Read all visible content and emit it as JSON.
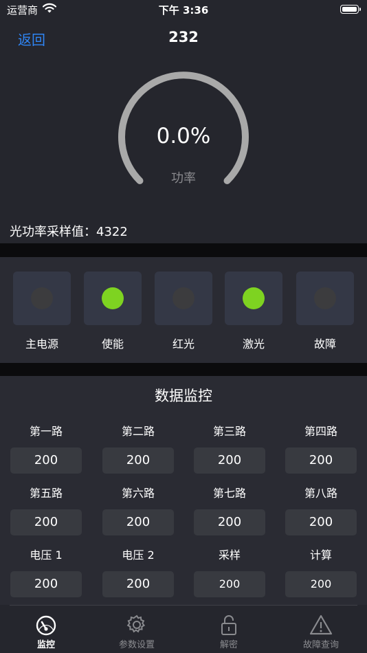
{
  "status_bar": {
    "carrier": "运营商",
    "time": "下午 3:36"
  },
  "nav": {
    "back_label": "返回",
    "title": "232"
  },
  "gauge": {
    "value_text": "0.0%",
    "label": "功率",
    "level_fraction": 0.0
  },
  "sample": {
    "label": "光功率采样值：",
    "value": "4322"
  },
  "indicators": [
    {
      "label": "主电源",
      "on": false
    },
    {
      "label": "使能",
      "on": true
    },
    {
      "label": "红光",
      "on": false
    },
    {
      "label": "激光",
      "on": true
    },
    {
      "label": "故障",
      "on": false
    }
  ],
  "monitor": {
    "title": "数据监控",
    "cells": [
      {
        "label": "第一路",
        "value": "200"
      },
      {
        "label": "第二路",
        "value": "200"
      },
      {
        "label": "第三路",
        "value": "200"
      },
      {
        "label": "第四路",
        "value": "200"
      },
      {
        "label": "第五路",
        "value": "200"
      },
      {
        "label": "第六路",
        "value": "200"
      },
      {
        "label": "第七路",
        "value": "200"
      },
      {
        "label": "第八路",
        "value": "200"
      },
      {
        "label": "电压 1",
        "value": "200"
      },
      {
        "label": "电压 2",
        "value": "200"
      },
      {
        "label": "采样",
        "value": "200"
      },
      {
        "label": "计算",
        "value": "200"
      }
    ]
  },
  "tabs": [
    {
      "label": "监控",
      "icon": "gauge-icon",
      "active": true
    },
    {
      "label": "参数设置",
      "icon": "gear-icon",
      "active": false
    },
    {
      "label": "解密",
      "icon": "lock-icon",
      "active": false
    },
    {
      "label": "故障查询",
      "icon": "warning-icon",
      "active": false
    }
  ],
  "colors": {
    "background": "#25262d",
    "accent": "#2f86f6",
    "indicator_on": "#7ed321",
    "indicator_off": "#3c3c3e",
    "gauge_track": "#a9a9a9"
  }
}
